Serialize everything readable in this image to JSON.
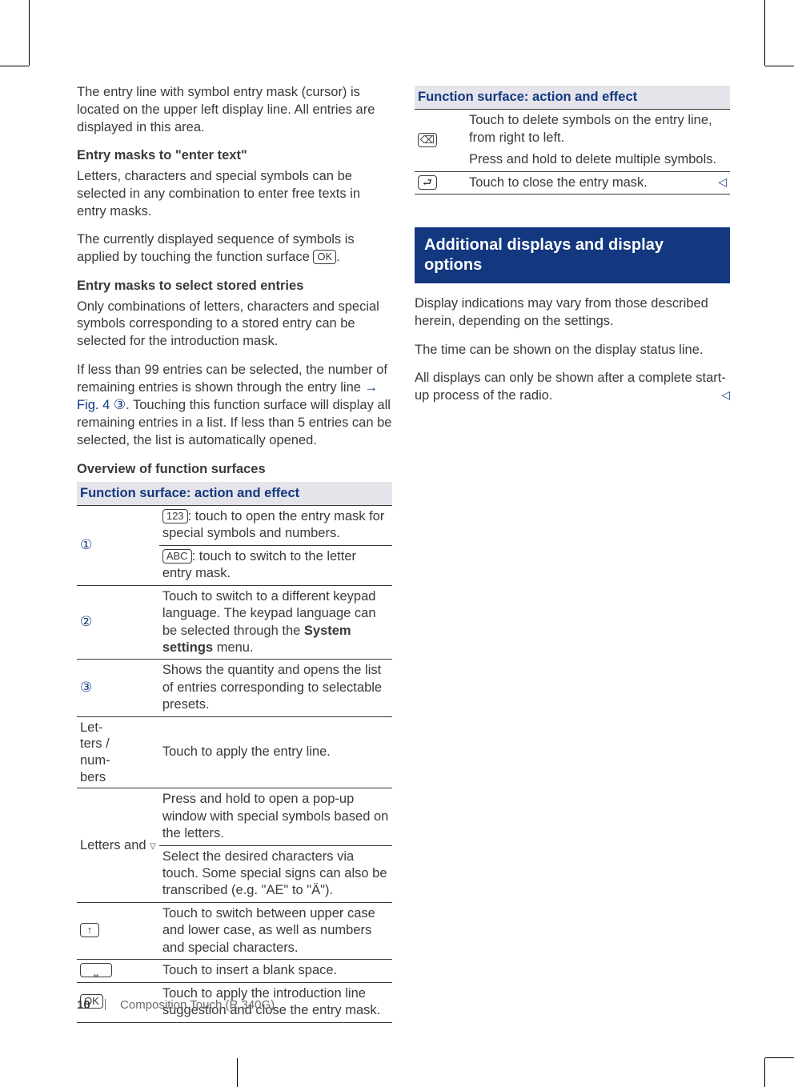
{
  "left": {
    "p1": "The entry line with symbol entry mask (cursor) is located on the upper left display line. All entries are displayed in this area.",
    "h1": "Entry masks to \"enter text\"",
    "p2": "Letters, characters and special symbols can be selected in any combination to enter free texts in entry masks.",
    "p3a": "The currently displayed sequence of symbols is applied by touching the function surface ",
    "key_ok": "OK",
    "p3b": ".",
    "h2": "Entry masks to select stored entries",
    "p4": "Only combinations of letters, characters and special symbols corresponding to a stored entry can be selected for the introduction mask.",
    "p5a": "If less than 99 entries can be selected, the number of remaining entries is shown through the entry line ",
    "p5_link": "→ Fig. 4",
    "p5_circ": "③",
    "p5b": ". Touching this function surface will display all remaining entries in a list. If less than 5 entries can be selected, the list is automatically opened.",
    "h3": "Overview of function surfaces",
    "th": "Function surface: action and effect",
    "r1_lbl": "①",
    "r1_key1": "123",
    "r1_txt1": ": touch to open the entry mask for special symbols and numbers.",
    "r1_key2": "ABC",
    "r1_txt2": ": touch to switch to the letter entry mask.",
    "r2_lbl": "②",
    "r2_txt_a": "Touch to switch to a different keypad language. The keypad language can be selected through the ",
    "r2_txt_k": "System settings",
    "r2_txt_b": " menu.",
    "r3_lbl": "③",
    "r3_txt": "Shows the quantity and opens the list of entries corresponding to selectable presets.",
    "r4_lbl": "Let-\nters /\nnum-\nbers",
    "r4_txt": "Touch to apply the entry line.",
    "r5_lbl": "Letters and ▿",
    "r5_txt1": "Press and hold to open a pop-up window with special symbols based on the letters.",
    "r5_txt2": "Select the desired characters via touch. Some special signs can also be transcribed (e.g. \"AE\" to \"Ä\").",
    "r6_lbl": "⇧",
    "r6_txt": "Touch to switch between upper case and lower case, as well as numbers and special characters.",
    "r7_lbl": "␣",
    "r7_txt": "Touch to insert a blank space.",
    "r8_lbl": "OK",
    "r8_txt": "Touch to apply the introduction line suggestion and close the entry mask."
  },
  "right": {
    "th": "Function surface: action and effect",
    "r1_lbl": "⌫",
    "r1_txt1": "Touch to delete symbols on the entry line, from right to left.",
    "r1_txt2": "Press and hold to delete multiple symbols.",
    "r2_lbl": "↩",
    "r2_txt": "Touch to close the entry mask.",
    "section_title": "Additional displays and display options",
    "p1": "Display indications may vary from those described herein, depending on the settings.",
    "p2": "The time can be shown on the display status line.",
    "p3": "All displays can only be shown after a complete start-up process of the radio."
  },
  "footer": {
    "page_number": "10",
    "chapter": "Composition Touch (R 340G)"
  }
}
